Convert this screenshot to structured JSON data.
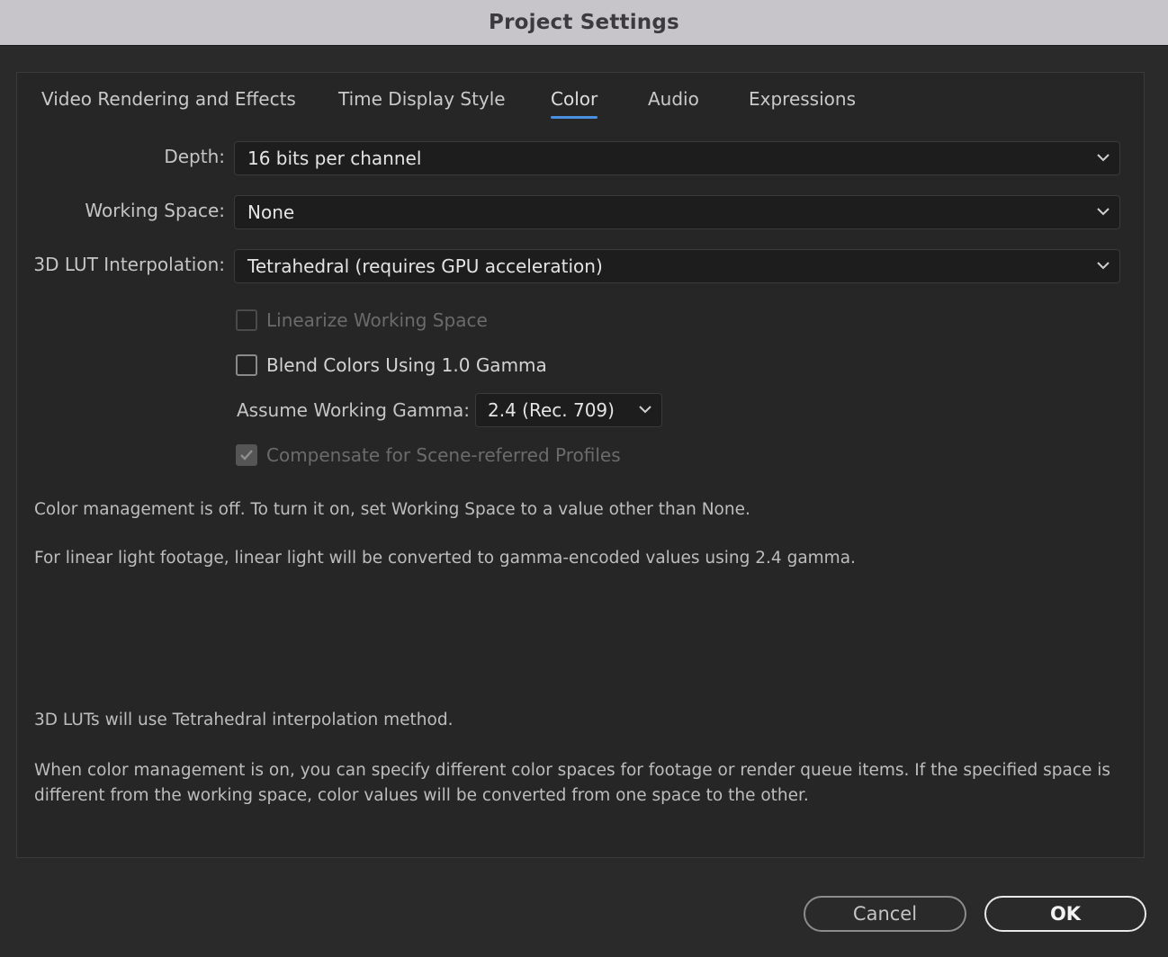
{
  "window": {
    "title": "Project Settings"
  },
  "tabs": [
    {
      "label": "Video Rendering and Effects",
      "active": false
    },
    {
      "label": "Time Display Style",
      "active": false
    },
    {
      "label": "Color",
      "active": true
    },
    {
      "label": "Audio",
      "active": false
    },
    {
      "label": "Expressions",
      "active": false
    }
  ],
  "fields": {
    "depth": {
      "label": "Depth:",
      "value": "16 bits per channel"
    },
    "working_space": {
      "label": "Working Space:",
      "value": "None"
    },
    "lut_interpolation": {
      "label": "3D LUT Interpolation:",
      "value": "Tetrahedral (requires GPU acceleration)"
    }
  },
  "options": {
    "linearize": {
      "label": "Linearize Working Space",
      "checked": false,
      "enabled": false
    },
    "blend_gamma": {
      "label": "Blend Colors Using 1.0 Gamma",
      "checked": false,
      "enabled": true
    },
    "assume_gamma": {
      "label": "Assume Working Gamma:",
      "value": "2.4 (Rec. 709)"
    },
    "compensate": {
      "label": "Compensate for Scene-referred Profiles",
      "checked": true,
      "enabled": false
    }
  },
  "info": {
    "line1": "Color management is off. To turn it on, set Working Space to a value other than None.",
    "line2": "For linear light footage, linear light will be converted to gamma-encoded values using 2.4 gamma.",
    "line3": "3D LUTs will use Tetrahedral interpolation method.",
    "line4a": "When color management is on, you can specify different color spaces for footage or render queue items. If the specified space is",
    "line4b": "different from the working space, color values will be converted from one space to the other."
  },
  "buttons": {
    "cancel": "Cancel",
    "ok": "OK"
  },
  "colors": {
    "accent": "#4a8fe0",
    "background": "#2a2a2a",
    "titlebar": "#c8c5ca"
  }
}
